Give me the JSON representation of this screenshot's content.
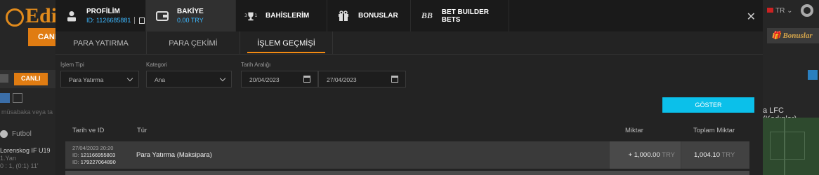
{
  "background": {
    "canl_label": "CANL",
    "canli_label": "CANLI",
    "search_placeholder": "müsabaka veya ta",
    "sport": "Futbol",
    "match": {
      "team": "Lorenskog IF U19",
      "half": "1.Yarı",
      "score": "0 : 1, (0:1) 11'"
    },
    "lang": "TR",
    "bonus_label": "Bonuslar",
    "team_right": "a LFC (Kadınlar)"
  },
  "topnav": {
    "profile": {
      "title": "PROFİLİM",
      "id": "ID: 1126685881"
    },
    "balance": {
      "title": "BAKİYE",
      "amount": "0.00 TRY"
    },
    "bets": "BAHİSLERİM",
    "bonuses": "BONUSLAR",
    "bet_builder": "BET BUILDER BETS"
  },
  "subnav": {
    "tabs": [
      "PARA YATIRMA",
      "PARA ÇEKİMİ",
      "İŞLEM GEÇMİŞİ"
    ],
    "active": "İŞLEM GEÇMİŞİ"
  },
  "filters": {
    "type_label": "İşlem Tipi",
    "type_value": "Para Yatırma",
    "category_label": "Kategori",
    "category_value": "Ana",
    "date_label": "Tarih Aralığı",
    "date_from": "20/04/2023",
    "date_to": "27/04/2023",
    "show_button": "GÖSTER"
  },
  "table": {
    "headers": {
      "date": "Tarih ve ID",
      "type": "Tür",
      "amount": "Miktar",
      "total": "Toplam Miktar"
    },
    "rows": [
      {
        "date": "27/04/2023 20:20",
        "id1_label": "ID:",
        "id1": "121166955803",
        "id2_label": "ID:",
        "id2": "179227064890",
        "type": "Para Yatırma (Maksipara)",
        "amount": "+ 1,000.00",
        "amount_cur": "TRY",
        "total": "1,004.10",
        "total_cur": "TRY"
      }
    ]
  },
  "colors": {
    "accent": "#0bc0ea",
    "brand_orange": "#f28a12",
    "balance_blue": "#3db8ff"
  }
}
